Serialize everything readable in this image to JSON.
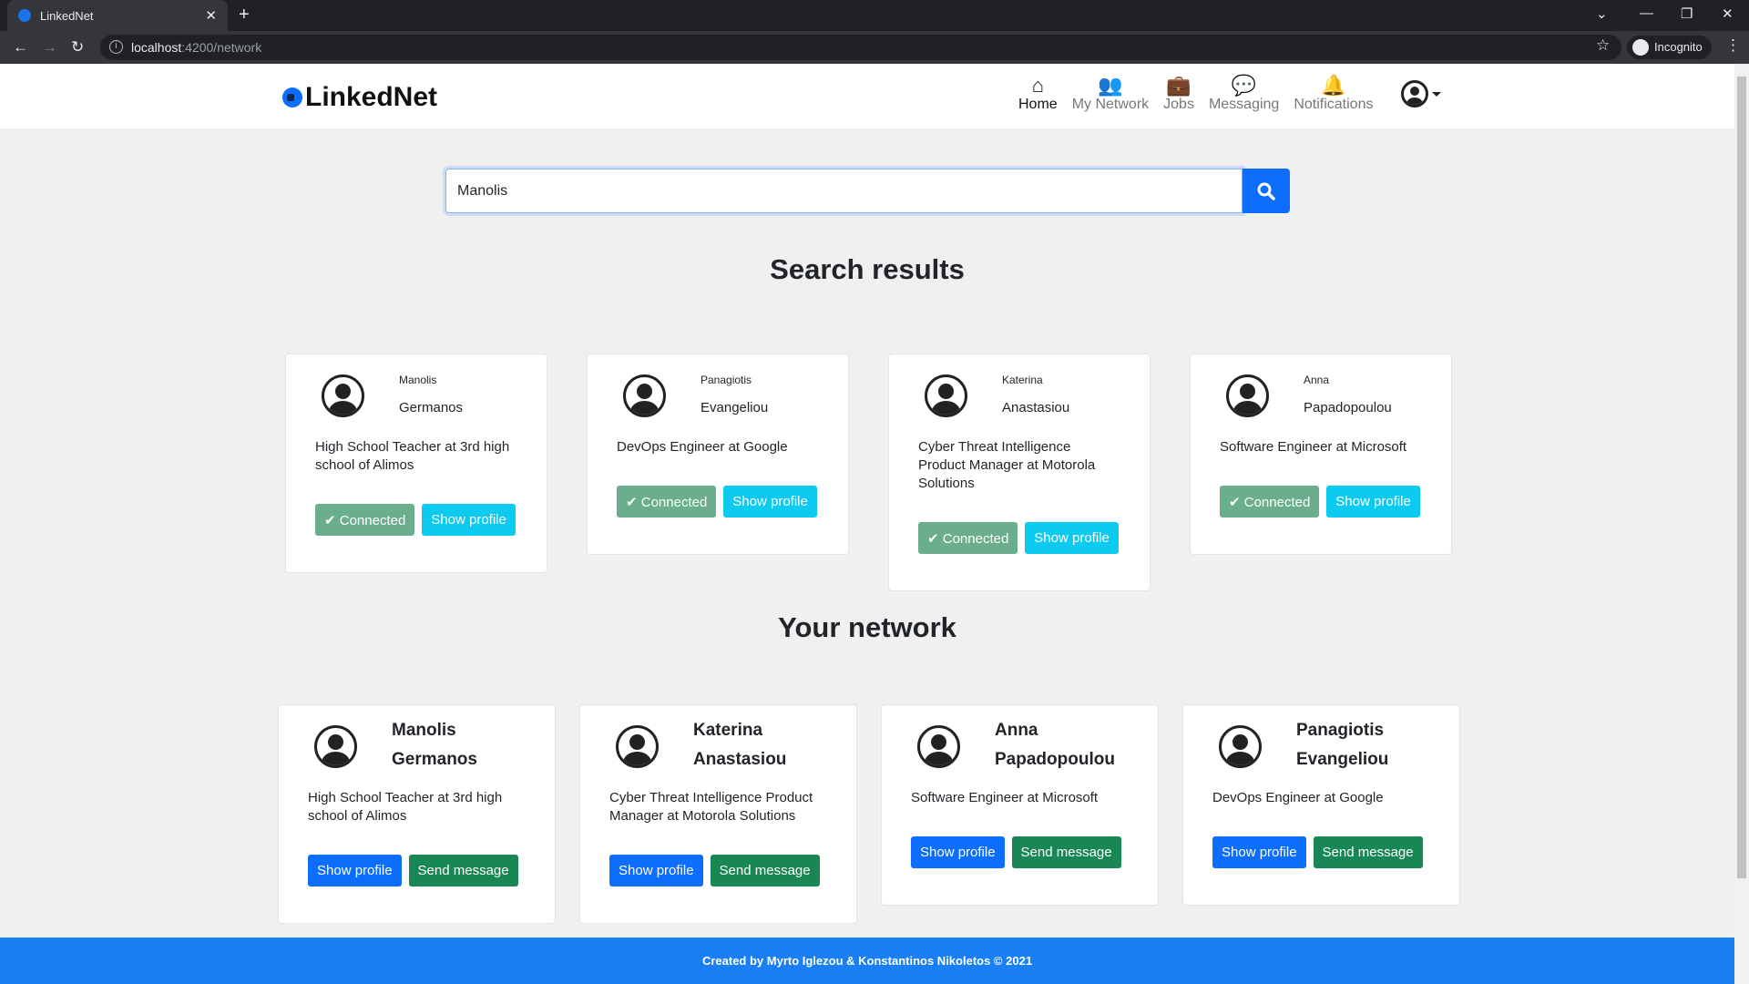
{
  "browser": {
    "tab_title": "LinkedNet",
    "url_host": "localhost",
    "url_path": ":4200/network",
    "incognito_label": "Incognito"
  },
  "app": {
    "logo": "LinkedNet"
  },
  "nav": [
    {
      "label": "Home",
      "icon": "home-icon",
      "glyph": "⌂"
    },
    {
      "label": "My Network",
      "icon": "users-icon",
      "glyph": "👥"
    },
    {
      "label": "Jobs",
      "icon": "briefcase-icon",
      "glyph": "💼"
    },
    {
      "label": "Messaging",
      "icon": "chat-icon",
      "glyph": "💬"
    },
    {
      "label": "Notifications",
      "icon": "bell-icon",
      "glyph": "🔔"
    }
  ],
  "search": {
    "value": "Manolis",
    "placeholder": ""
  },
  "search_results": {
    "title": "Search results",
    "connected_label": "✔ Connected",
    "show_profile_label": "Show profile",
    "people": [
      {
        "first": "Manolis",
        "last": "Germanos",
        "desc": "High School Teacher at 3rd high school of Alimos"
      },
      {
        "first": "Panagiotis",
        "last": "Evangeliou",
        "desc": "DevOps Engineer at Google"
      },
      {
        "first": "Katerina",
        "last": "Anastasiou",
        "desc": "Cyber Threat Intelligence Product Manager at Motorola Solutions"
      },
      {
        "first": "Anna",
        "last": "Papadopoulou",
        "desc": "Software Engineer at Microsoft"
      }
    ]
  },
  "network": {
    "title": "Your network",
    "show_profile_label": "Show profile",
    "send_message_label": "Send message",
    "people": [
      {
        "first": "Manolis",
        "last": "Germanos",
        "desc": "High School Teacher at 3rd high school of Alimos"
      },
      {
        "first": "Katerina",
        "last": "Anastasiou",
        "desc": "Cyber Threat Intelligence Product Manager at Motorola Solutions"
      },
      {
        "first": "Anna",
        "last": "Papadopoulou",
        "desc": "Software Engineer at Microsoft"
      },
      {
        "first": "Panagiotis",
        "last": "Evangeliou",
        "desc": "DevOps Engineer at Google"
      }
    ]
  },
  "footer": {
    "text": "Created by Myrto Iglezou & Konstantinos Nikoletos © 2021"
  },
  "colors": {
    "primary": "#0d6efd",
    "success": "#198754",
    "info": "#0dcaf0",
    "footer": "#1a7ff5"
  }
}
